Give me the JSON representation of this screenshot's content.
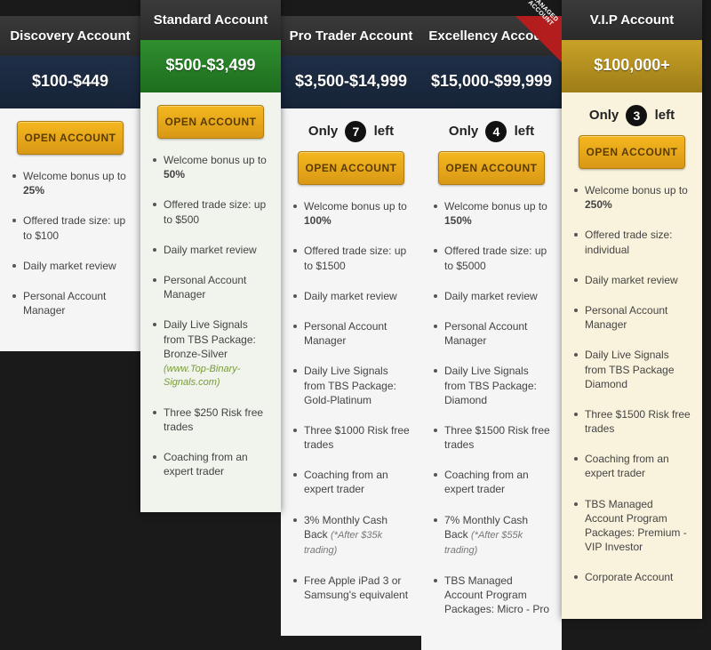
{
  "labels": {
    "open_account": "OPEN ACCOUNT",
    "only": "Only",
    "left": "left"
  },
  "ribbon": "MANAGED ACCOUNT",
  "plans": [
    {
      "name": "Discovery Account",
      "price": "$100-$449",
      "only_left": null,
      "features": [
        {
          "text": "Welcome bonus up to ",
          "strong": "25%"
        },
        {
          "text": "Offered trade size: up to $100"
        },
        {
          "text": "Daily market review"
        },
        {
          "text": "Personal Account Manager"
        }
      ]
    },
    {
      "name": "Standard Account",
      "price": "$500-$3,499",
      "only_left": null,
      "features": [
        {
          "text": "Welcome bonus up to ",
          "strong": "50%"
        },
        {
          "text": "Offered trade size: up to $500"
        },
        {
          "text": "Daily market review"
        },
        {
          "text": "Personal Account Manager"
        },
        {
          "text": "Daily Live Signals from TBS Package: Bronze-Silver",
          "sub": "(www.Top-Binary-Signals.com)"
        },
        {
          "text": "Three $250 Risk free trades"
        },
        {
          "text": "Coaching from an expert trader"
        }
      ]
    },
    {
      "name": "Pro Trader Account",
      "price": "$3,500-$14,999",
      "only_left": "7",
      "features": [
        {
          "text": "Welcome bonus up to ",
          "strong": "100%"
        },
        {
          "text": "Offered trade size: up to $1500"
        },
        {
          "text": "Daily market review"
        },
        {
          "text": "Personal Account Manager"
        },
        {
          "text": "Daily Live Signals from TBS Package: Gold-Platinum"
        },
        {
          "text": "Three $1000 Risk free trades"
        },
        {
          "text": "Coaching from an expert trader"
        },
        {
          "text": "3% Monthly Cash Back ",
          "note": "(*After $35k trading)"
        },
        {
          "text": "Free Apple iPad 3 or Samsung's equivalent"
        }
      ]
    },
    {
      "name": "Excellency Account",
      "price": "$15,000-$99,999",
      "only_left": "4",
      "ribbon": true,
      "features": [
        {
          "text": "Welcome bonus up to ",
          "strong": "150%"
        },
        {
          "text": "Offered trade size: up to $5000"
        },
        {
          "text": "Daily market review"
        },
        {
          "text": "Personal Account Manager"
        },
        {
          "text": "Daily Live Signals from TBS Package: Diamond"
        },
        {
          "text": "Three $1500 Risk free trades"
        },
        {
          "text": "Coaching from an expert trader"
        },
        {
          "text": "7% Monthly Cash Back ",
          "note": "(*After $55k trading)"
        },
        {
          "text": "TBS Managed Account Program Packages: Micro - Pro"
        }
      ]
    },
    {
      "name": "V.I.P Account",
      "price": "$100,000+",
      "only_left": "3",
      "features": [
        {
          "text": "Welcome bonus up to ",
          "strong": "250%"
        },
        {
          "text": "Offered trade size: individual"
        },
        {
          "text": "Daily market review"
        },
        {
          "text": "Personal Account Manager"
        },
        {
          "text": "Daily Live Signals from TBS Package Diamond"
        },
        {
          "text": "Three $1500 Risk free trades"
        },
        {
          "text": "Coaching from an expert trader"
        },
        {
          "text": "TBS Managed Account Program Packages: Premium - VIP Investor"
        },
        {
          "text": "Corporate Account"
        }
      ]
    }
  ]
}
